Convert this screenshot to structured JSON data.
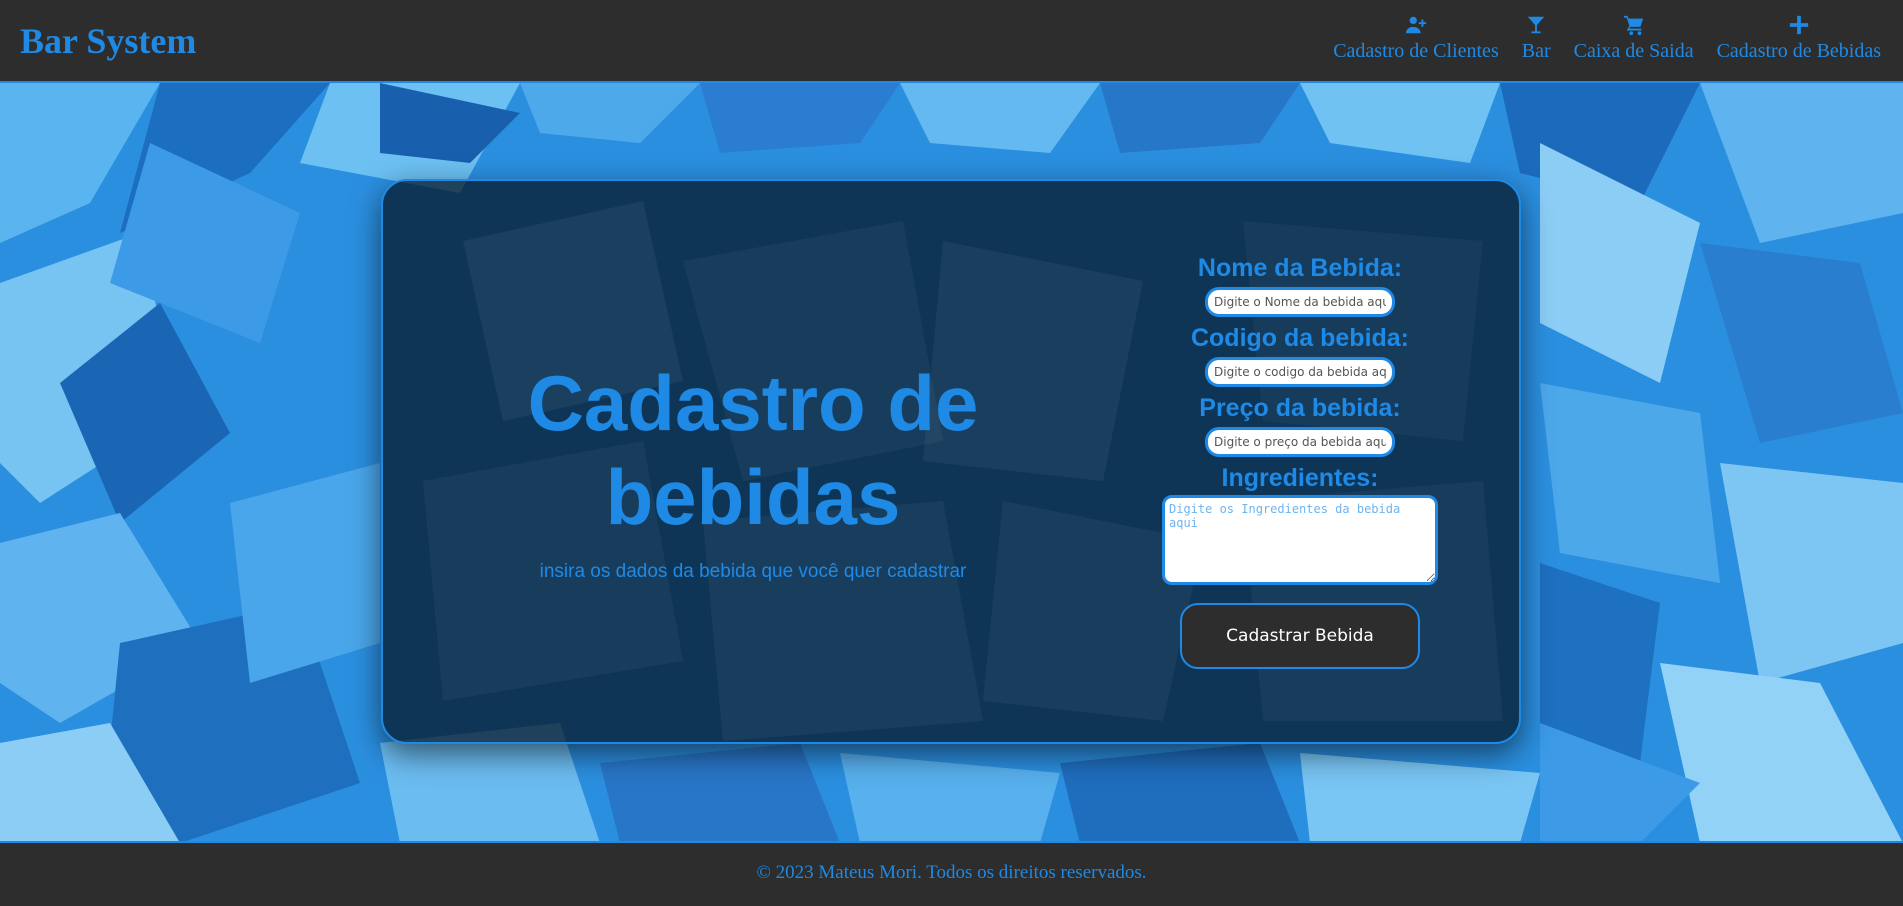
{
  "header": {
    "brand": "Bar System",
    "nav": [
      {
        "label": "Cadastro de Clientes",
        "icon": "user-plus-icon"
      },
      {
        "label": "Bar",
        "icon": "cocktail-glass-icon"
      },
      {
        "label": "Caixa de Saida",
        "icon": "shopping-cart-icon"
      },
      {
        "label": "Cadastro de Bebidas",
        "icon": "plus-icon"
      }
    ]
  },
  "hero": {
    "title": "Cadastro de bebidas",
    "subtitle": "insira os dados da bebida que você quer cadastrar"
  },
  "form": {
    "name_label": "Nome da Bebida:",
    "name_placeholder": "Digite o Nome da bebida aqui",
    "code_label": "Codigo da bebida:",
    "code_placeholder": "Digite o codigo da bebida aqui",
    "price_label": "Preço da bebida:",
    "price_placeholder": "Digite o preço da bebida aqui",
    "ingredients_label": "Ingredientes:",
    "ingredients_placeholder": "Digite os Ingredientes da bebida aqui",
    "submit_label": "Cadastrar Bebida"
  },
  "footer": {
    "text": "© 2023 Mateus Mori. Todos os direitos reservados."
  },
  "colors": {
    "accent": "#1e8ae6",
    "bar_background": "#2d2d2d",
    "button_text": "#ffffff"
  }
}
